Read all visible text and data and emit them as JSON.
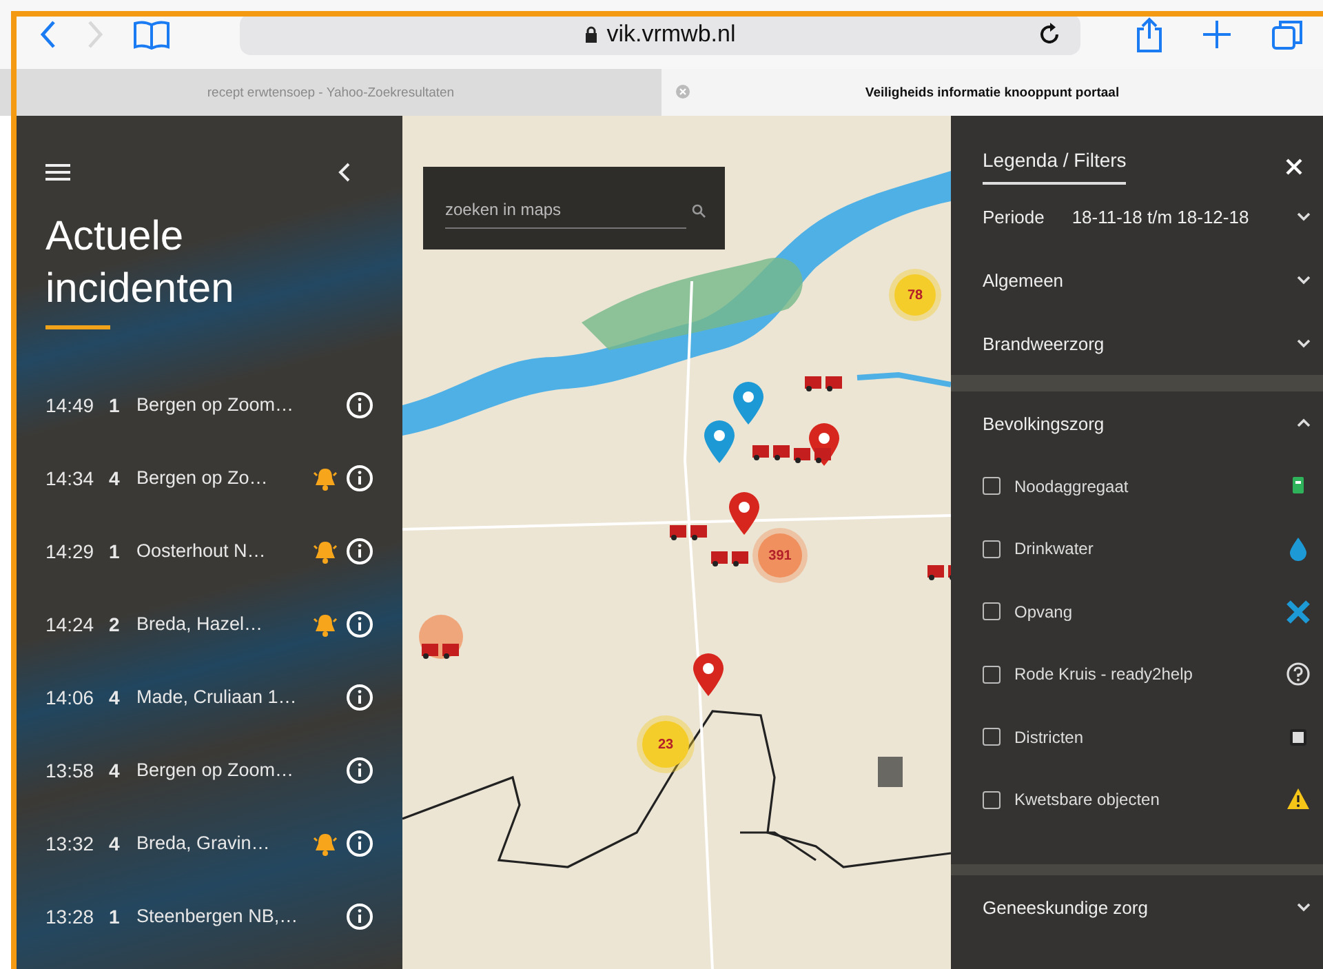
{
  "browser": {
    "forward_enabled": false,
    "address": "vik.vrmwb.nl",
    "tabs": [
      {
        "title": "recept erwtensoep - Yahoo-Zoekresultaten",
        "selected": false
      },
      {
        "title": "Veiligheids informatie knooppunt portaal",
        "selected": true
      }
    ]
  },
  "incidents": {
    "title": "Actuele incidenten",
    "rows": [
      {
        "time": "14:49",
        "priority": "1",
        "location": "Bergen op Zoom…",
        "alarm": false
      },
      {
        "time": "14:34",
        "priority": "4",
        "location": "Bergen op Zo…",
        "alarm": true
      },
      {
        "time": "14:29",
        "priority": "1",
        "location": "Oosterhout N…",
        "alarm": true
      },
      {
        "time": "14:24",
        "priority": "2",
        "location": "Breda, Hazel…",
        "alarm": true
      },
      {
        "time": "14:06",
        "priority": "4",
        "location": "Made, Cruliaan 1…",
        "alarm": false
      },
      {
        "time": "13:58",
        "priority": "4",
        "location": "Bergen op Zoom…",
        "alarm": false
      },
      {
        "time": "13:32",
        "priority": "4",
        "location": "Breda, Gravin…",
        "alarm": true
      },
      {
        "time": "13:28",
        "priority": "1",
        "location": "Steenbergen NB,…",
        "alarm": false
      }
    ]
  },
  "map": {
    "search": {
      "placeholder": "zoeken in maps"
    },
    "clusters": [
      {
        "count": "78",
        "color": "#f5cd2a"
      },
      {
        "count": "391",
        "color": "#f0905e"
      },
      {
        "count": "23",
        "color": "#f5cd2a"
      }
    ]
  },
  "filters": {
    "title": "Legenda / Filters",
    "sections": [
      {
        "label": "Periode",
        "value": "18-11-18 t/m 18-12-18",
        "expanded": false
      },
      {
        "label": "Algemeen",
        "expanded": false
      },
      {
        "label": "Brandweerzorg",
        "expanded": false
      },
      {
        "label": "Bevolkingszorg",
        "expanded": true,
        "items": [
          {
            "label": "Noodaggregaat",
            "checked": false,
            "kind": "generator"
          },
          {
            "label": "Drinkwater",
            "checked": false,
            "kind": "water"
          },
          {
            "label": "Opvang",
            "checked": false,
            "kind": "shelter"
          },
          {
            "label": "Rode Kruis - ready2help",
            "checked": false,
            "kind": "help"
          },
          {
            "label": "Districten",
            "checked": false,
            "kind": "district"
          },
          {
            "label": "Kwetsbare objecten",
            "checked": false,
            "kind": "warning"
          }
        ]
      },
      {
        "label": "Geneeskundige zorg",
        "expanded": false
      }
    ]
  }
}
